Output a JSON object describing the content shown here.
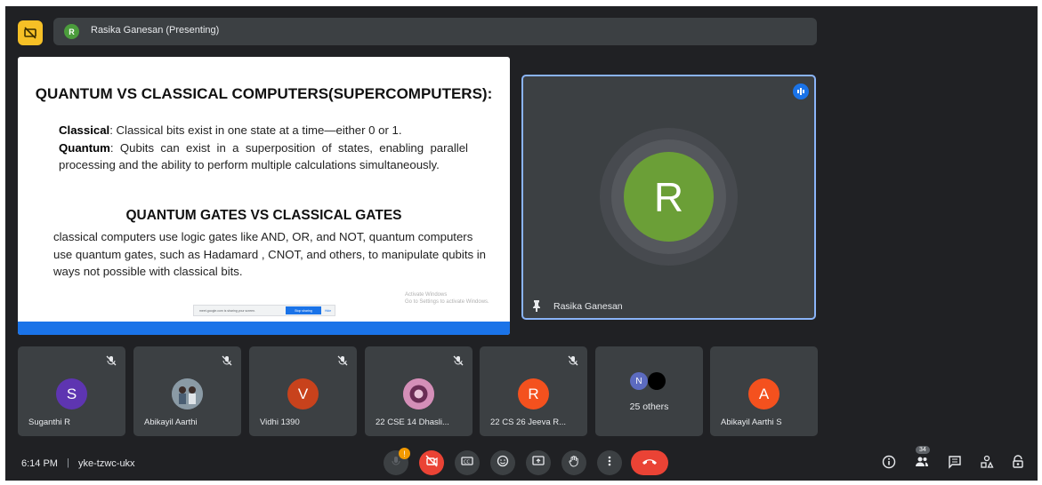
{
  "presenter_bar": {
    "avatar_initial": "R",
    "label": "Rasika Ganesan (Presenting)"
  },
  "slide": {
    "title": "QUANTUM VS CLASSICAL COMPUTERS(SUPERCOMPUTERS):",
    "classical_label": "Classical",
    "classical_text": ": Classical bits exist in one state at a time—either 0 or 1.",
    "quantum_label": "Quantum",
    "quantum_text": ": Qubits can exist in a superposition of states, enabling parallel processing and the ability to perform multiple calculations simultaneously.",
    "subtitle": "QUANTUM GATES VS CLASSICAL GATES",
    "gates_text": "classical computers use logic gates like AND, OR, and NOT, quantum computers use quantum gates, such as Hadamard , CNOT, and others, to manipulate qubits in ways not possible with classical bits.",
    "share_notice": "meet.google.com is sharing your screen.",
    "stop_sharing": "Stop sharing",
    "hide": "Hide",
    "activate_title": "Activate Windows",
    "activate_sub": "Go to Settings to activate Windows."
  },
  "speaker": {
    "initial": "R",
    "name": "Rasika Ganesan",
    "avatar_color": "#6b9f37"
  },
  "participants": [
    {
      "initial": "S",
      "name": "Suganthi R",
      "color": "#5e35b1"
    },
    {
      "initial": "",
      "name": "Abikayil Aarthi",
      "color": "#6d7b84"
    },
    {
      "initial": "V",
      "name": "Vidhi 1390",
      "color": "#c8421c"
    },
    {
      "initial": "",
      "name": "22 CSE 14 Dhasli...",
      "color": "#b35a8c"
    },
    {
      "initial": "R",
      "name": "22 CS 26 Jeeva R...",
      "color": "#f4511e"
    },
    {
      "initial": "A",
      "name": "Abikayil Aarthi S",
      "color": "#f4511e"
    }
  ],
  "others": {
    "initial": "N",
    "label": "25 others"
  },
  "bottom": {
    "time": "6:14 PM",
    "separator": "|",
    "meeting_code": "yke-tzwc-ukx",
    "people_count": "34"
  },
  "icons": {
    "present": "stop-presenting-icon",
    "mic": "mic-off-icon",
    "camera": "camera-off-icon",
    "captions": "captions-icon",
    "emoji": "emoji-icon",
    "present_screen": "present-screen-icon",
    "hand": "raise-hand-icon",
    "more": "more-options-icon",
    "hangup": "hang-up-icon",
    "info": "info-icon",
    "people": "people-icon",
    "chat": "chat-icon",
    "activities": "activities-icon",
    "host": "host-controls-icon"
  }
}
